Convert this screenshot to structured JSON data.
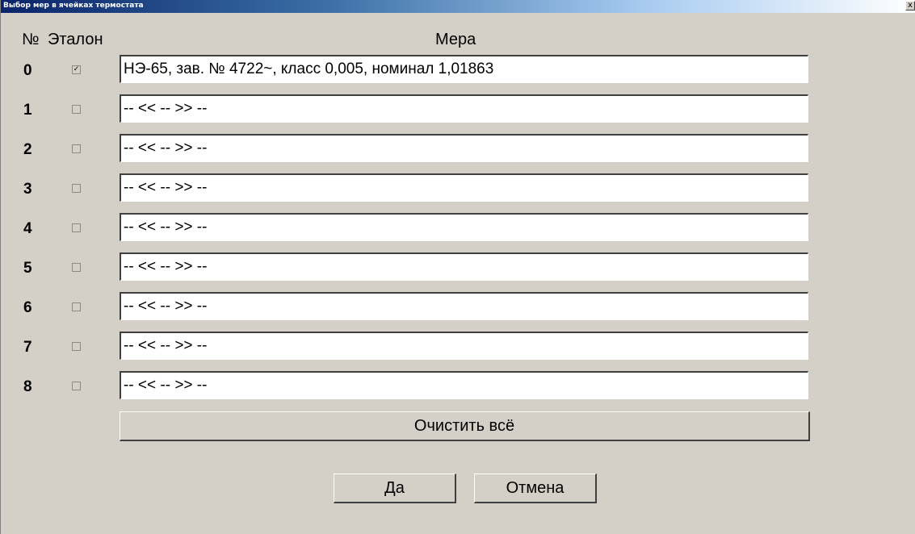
{
  "window": {
    "title": "Выбор мер в ячейках термостата",
    "close_glyph": "x"
  },
  "header": {
    "num_label": "№",
    "reference_label": "Эталон",
    "measure_label": "Мера"
  },
  "rows": [
    {
      "num": "0",
      "checked": true,
      "check_glyph": "✓",
      "value": "НЭ-65, зав. № 4722~, класс 0,005, номинал 1,01863"
    },
    {
      "num": "1",
      "checked": false,
      "check_glyph": "",
      "value": "-- << -- >> --"
    },
    {
      "num": "2",
      "checked": false,
      "check_glyph": "",
      "value": "-- << -- >> --"
    },
    {
      "num": "3",
      "checked": false,
      "check_glyph": "",
      "value": "-- << -- >> --"
    },
    {
      "num": "4",
      "checked": false,
      "check_glyph": "",
      "value": "-- << -- >> --"
    },
    {
      "num": "5",
      "checked": false,
      "check_glyph": "",
      "value": "-- << -- >> --"
    },
    {
      "num": "6",
      "checked": false,
      "check_glyph": "",
      "value": "-- << -- >> --"
    },
    {
      "num": "7",
      "checked": false,
      "check_glyph": "",
      "value": "-- << -- >> --"
    },
    {
      "num": "8",
      "checked": false,
      "check_glyph": "",
      "value": "-- << -- >> --"
    }
  ],
  "buttons": {
    "clear_all": "Очистить всё",
    "ok": "Да",
    "cancel": "Отмена"
  }
}
